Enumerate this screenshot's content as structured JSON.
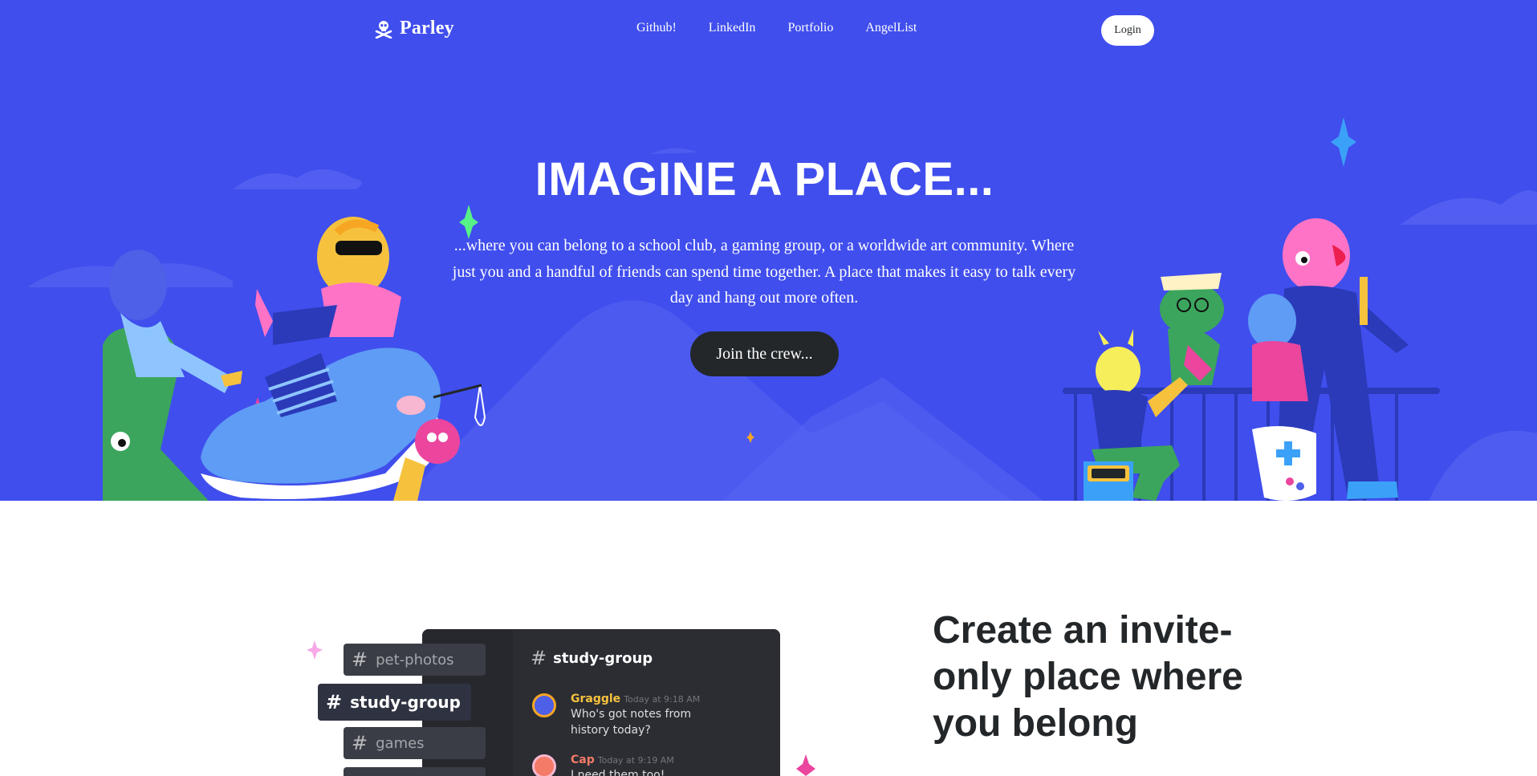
{
  "nav": {
    "logo_text": "Parley",
    "links": [
      "Github!",
      "LinkedIn",
      "Portfolio",
      "AngelList"
    ],
    "login_label": "Login"
  },
  "hero": {
    "title": "IMAGINE A PLACE...",
    "subtitle": "...where you can belong to a school club, a gaming group, or a worldwide art community. Where just you and a handful of friends can spend time together. A place that makes it easy to talk every day and hang out more often.",
    "cta_label": "Join the crew..."
  },
  "feature": {
    "title": "Create an invite-only place where you belong",
    "channels": [
      "pet-photos",
      "study-group",
      "games"
    ],
    "active_channel": "study-group",
    "panel_channel": "study-group",
    "messages": [
      {
        "author": "Graggle",
        "time": "Today at 9:18 AM",
        "text": "Who's got notes from history today?",
        "color": "#f6c23e"
      },
      {
        "author": "Cap",
        "time": "Today at 9:19 AM",
        "text": "I need them too!",
        "color": "#f47b67"
      }
    ]
  },
  "colors": {
    "brand": "#404eed",
    "dark": "#23272a",
    "white": "#ffffff"
  },
  "icons": {
    "logo": "skull-crossbones-icon",
    "channel": "hash-icon"
  }
}
